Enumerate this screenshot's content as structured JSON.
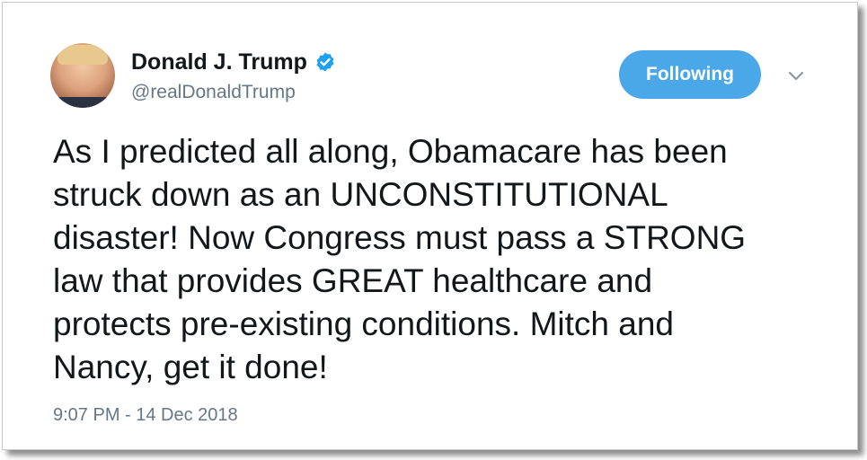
{
  "tweet": {
    "author": {
      "display_name": "Donald J. Trump",
      "handle": "@realDonaldTrump",
      "verified": true,
      "avatar_icon": "profile-photo"
    },
    "follow_button_label": "Following",
    "menu_icon": "chevron-down-icon",
    "text": "As I predicted all along, Obamacare has been\nstruck down as an UNCONSTITUTIONAL\ndisaster! Now Congress must pass a STRONG\nlaw that provides GREAT healthcare and\nprotects pre-existing conditions. Mitch and\nNancy, get it done!",
    "timestamp": "9:07 PM - 14 Dec 2018"
  },
  "colors": {
    "accent": "#4aa7e8",
    "verified_badge": "#1da1f2",
    "primary_text": "#14171a",
    "secondary_text": "#657786"
  }
}
